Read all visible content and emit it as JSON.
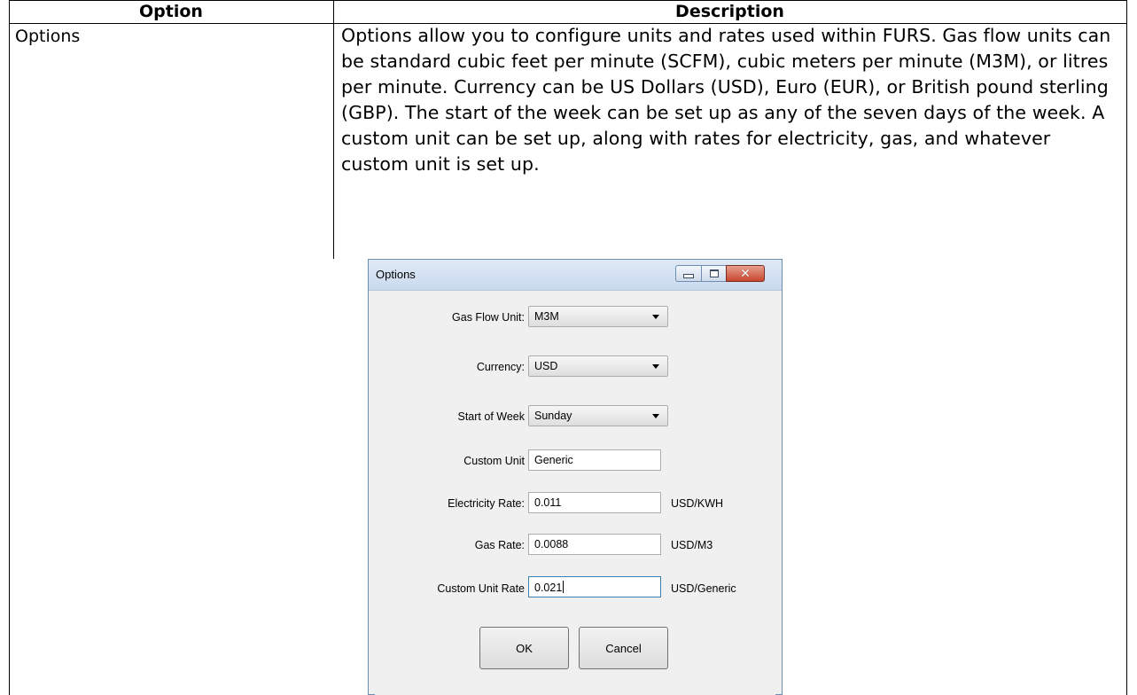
{
  "table": {
    "headers": {
      "option": "Option",
      "description": "Description"
    },
    "row": {
      "option": "Options",
      "description": "Options allow you to configure units and rates used within FURS. Gas flow units can be standard cubic feet per minute (SCFM), cubic meters per minute (M3M), or litres per minute. Currency can be US Dollars (USD), Euro (EUR), or British pound sterling (GBP). The start of the week can be set up as any of the seven days of the week. A custom unit can be set up, along with rates for electricity, gas, and whatever custom unit is set up."
    }
  },
  "dialog": {
    "title": "Options",
    "fields": {
      "gas_flow_unit": {
        "label": "Gas Flow Unit:",
        "value": "M3M"
      },
      "currency": {
        "label": "Currency:",
        "value": "USD"
      },
      "start_of_week": {
        "label": "Start of Week",
        "value": "Sunday"
      },
      "custom_unit": {
        "label": "Custom Unit",
        "value": "Generic"
      },
      "electricity_rate": {
        "label": "Electricity Rate:",
        "value": "0.011",
        "unit": "USD/KWH"
      },
      "gas_rate": {
        "label": "Gas Rate:",
        "value": "0.0088",
        "unit": "USD/M3"
      },
      "custom_unit_rate": {
        "label": "Custom Unit Rate",
        "value": "0.021",
        "unit": "USD/Generic"
      }
    },
    "buttons": {
      "ok": "OK",
      "cancel": "Cancel"
    }
  }
}
